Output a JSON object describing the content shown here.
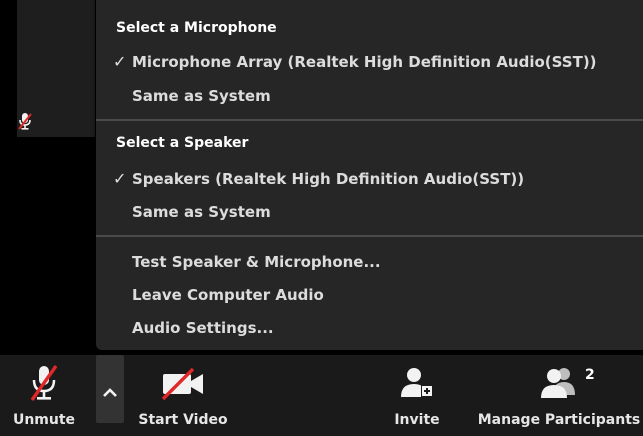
{
  "microphone_section": {
    "header": "Select a Microphone",
    "items": [
      {
        "label": "Microphone Array (Realtek High Definition Audio(SST))",
        "selected": true
      },
      {
        "label": "Same as System",
        "selected": false
      }
    ]
  },
  "speaker_section": {
    "header": "Select a Speaker",
    "items": [
      {
        "label": "Speakers (Realtek High Definition Audio(SST))",
        "selected": true
      },
      {
        "label": "Same as System",
        "selected": false
      }
    ]
  },
  "actions": [
    {
      "label": "Test Speaker & Microphone..."
    },
    {
      "label": "Leave Computer Audio"
    },
    {
      "label": "Audio Settings..."
    }
  ],
  "check_glyph": "✓",
  "toolbar": {
    "unmute_label": "Unmute",
    "start_video_label": "Start Video",
    "invite_label": "Invite",
    "manage_participants_label": "Manage Participants",
    "participant_count": "2"
  },
  "colors": {
    "menu_bg": "#262626",
    "toolbar_bg": "#1a1a1a",
    "mute_slash": "#e02828"
  },
  "icons": {
    "tile_mic": "muted-microphone-icon",
    "unmute": "muted-microphone-icon",
    "caret": "chevron-up-icon",
    "video": "video-off-icon",
    "invite": "add-person-icon",
    "participants": "participants-icon"
  }
}
